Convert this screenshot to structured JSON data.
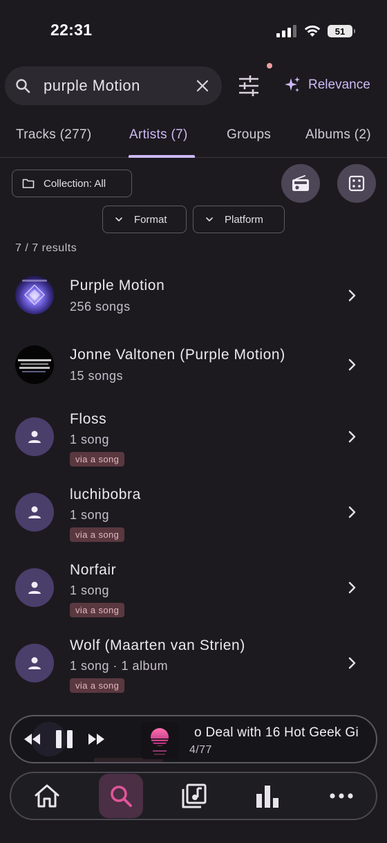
{
  "status_bar": {
    "time": "22:31",
    "battery": "51"
  },
  "search": {
    "query": "purple Motion",
    "sort_label": "Relevance"
  },
  "tabs": [
    {
      "label": "Tracks (277)"
    },
    {
      "label": "Artists (7)"
    },
    {
      "label": "Groups"
    },
    {
      "label": "Albums (2)"
    }
  ],
  "filters": {
    "collection_label": "Collection: All",
    "format_label": "Format",
    "platform_label": "Platform"
  },
  "results_count": "7 / 7 results",
  "artists": [
    {
      "name": "Purple Motion",
      "sub": "256 songs",
      "badge": ""
    },
    {
      "name": "Jonne Valtonen (Purple Motion)",
      "sub": "15 songs",
      "badge": ""
    },
    {
      "name": "Floss",
      "sub": "1 song",
      "badge": "via a song"
    },
    {
      "name": "luchibobra",
      "sub": "1 song",
      "badge": "via a song"
    },
    {
      "name": "Norfair",
      "sub": "1 song",
      "badge": "via a song"
    },
    {
      "name": "Wolf (Maarten van Strien)",
      "sub": "1 song · 1 album",
      "badge": "via a song"
    }
  ],
  "now_playing": {
    "title": "o Deal with 16 Hot Geek Gi",
    "position": "4/77"
  },
  "colors": {
    "accent": "#cdb9f5",
    "badge_bg": "#5a3840",
    "active_nav": "#e0559a"
  }
}
